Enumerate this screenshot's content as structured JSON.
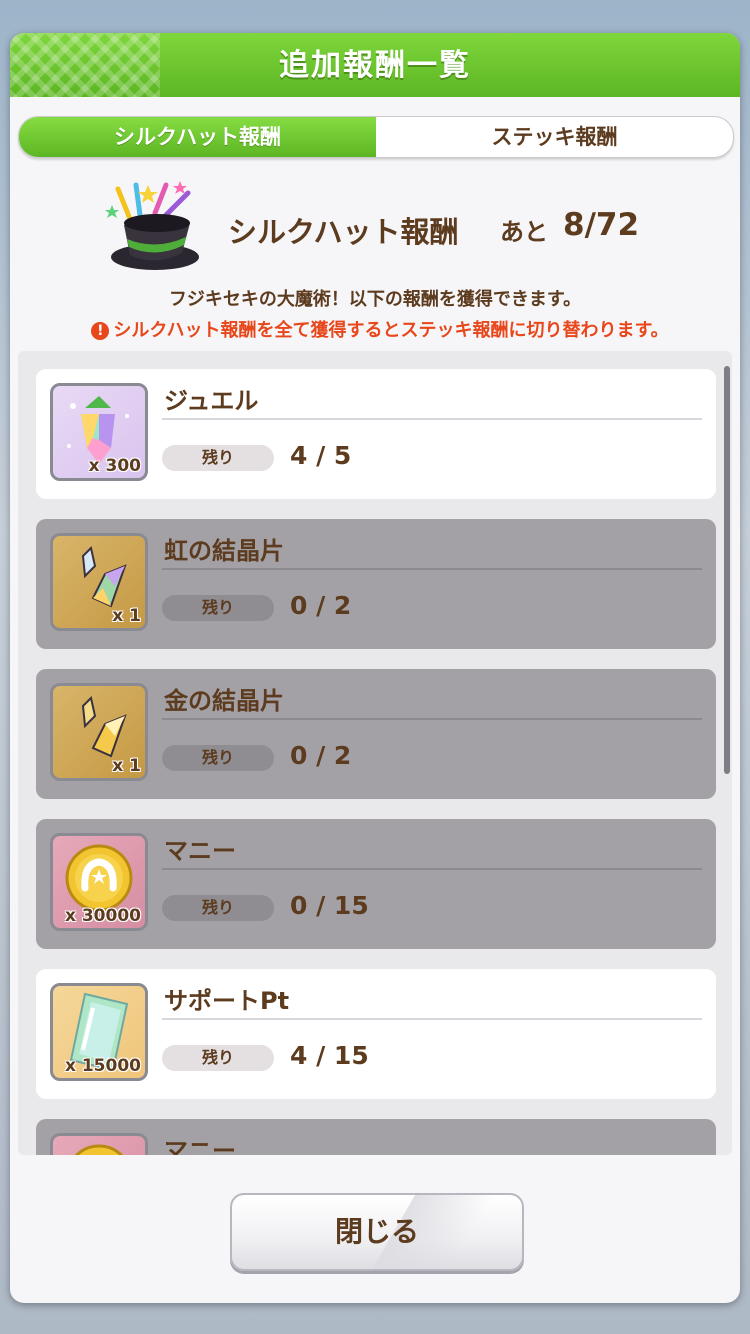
{
  "dialog": {
    "title": "追加報酬一覧",
    "tabs": [
      {
        "label": "シルクハット報酬",
        "active": true
      },
      {
        "label": "ステッキ報酬",
        "active": false
      }
    ],
    "header": {
      "label": "シルクハット報酬",
      "remain_label": "あと",
      "remain_value": "8/72"
    },
    "description": "フジキセキの大魔術！以下の報酬を獲得できます。",
    "warning": "シルクハット報酬を全て獲得するとステッキ報酬に切り替わります。",
    "remain_tag": "残り",
    "items": [
      {
        "name": "ジュエル",
        "qty": "x 300",
        "remaining": "4 / 5",
        "icon": "jewel-icon",
        "claimed_out": false
      },
      {
        "name": "虹の結晶片",
        "qty": "x 1",
        "remaining": "0 / 2",
        "icon": "rainbow-crystal-icon",
        "claimed_out": true
      },
      {
        "name": "金の結晶片",
        "qty": "x 1",
        "remaining": "0 / 2",
        "icon": "gold-crystal-icon",
        "claimed_out": true
      },
      {
        "name": "マニー",
        "qty": "x 30000",
        "remaining": "0 / 15",
        "icon": "money-coin-icon",
        "claimed_out": true
      },
      {
        "name": "サポートPt",
        "qty": "x 15000",
        "remaining": "4 / 15",
        "icon": "support-pt-icon",
        "claimed_out": false
      },
      {
        "name": "マニー",
        "qty": "",
        "remaining": "",
        "icon": "money-coin-icon",
        "claimed_out": true
      }
    ],
    "close_label": "閉じる"
  },
  "colors": {
    "title_green": "#5cb623",
    "text_brown": "#5c3b1e",
    "warning_orange": "#e8471b",
    "claimed_gray": "#a3a1a6"
  }
}
